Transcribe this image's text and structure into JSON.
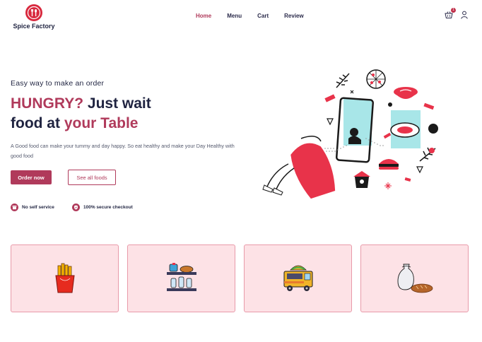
{
  "brand": {
    "name": "Spice Factory",
    "logo_icon": "fork-spoon-logo-icon"
  },
  "nav": {
    "items": [
      "Home",
      "Menu",
      "Cart",
      "Review"
    ],
    "active": "Home"
  },
  "header_icons": {
    "cart_icon": "basket-icon",
    "cart_count": "1",
    "user_icon": "user-icon"
  },
  "hero": {
    "eyebrow": "Easy way to make an order",
    "headline_part1": "HUNGRY?",
    "headline_part2": " Just wait",
    "headline_part3": "food at ",
    "headline_part4": "your Table",
    "description": "A Good food can make your tummy and day happy. So eat healthy and make your Day Healthy with good food",
    "primary_button": "Order now",
    "secondary_button": "See all foods",
    "illustration": "person-ordering-food-on-phone-illustration"
  },
  "features": [
    {
      "label": "No self service",
      "icon": "store-icon"
    },
    {
      "label": "100% secure checkout",
      "icon": "shield-check-icon"
    }
  ],
  "categories": [
    {
      "icon": "french-fries-icon"
    },
    {
      "icon": "bakery-shelf-icon"
    },
    {
      "icon": "food-truck-icon"
    },
    {
      "icon": "bread-and-flour-icon"
    }
  ],
  "colors": {
    "accent": "#b03a5b",
    "navy": "#1f2340",
    "card_bg": "#fde2e6",
    "card_border": "#e89aa9"
  }
}
